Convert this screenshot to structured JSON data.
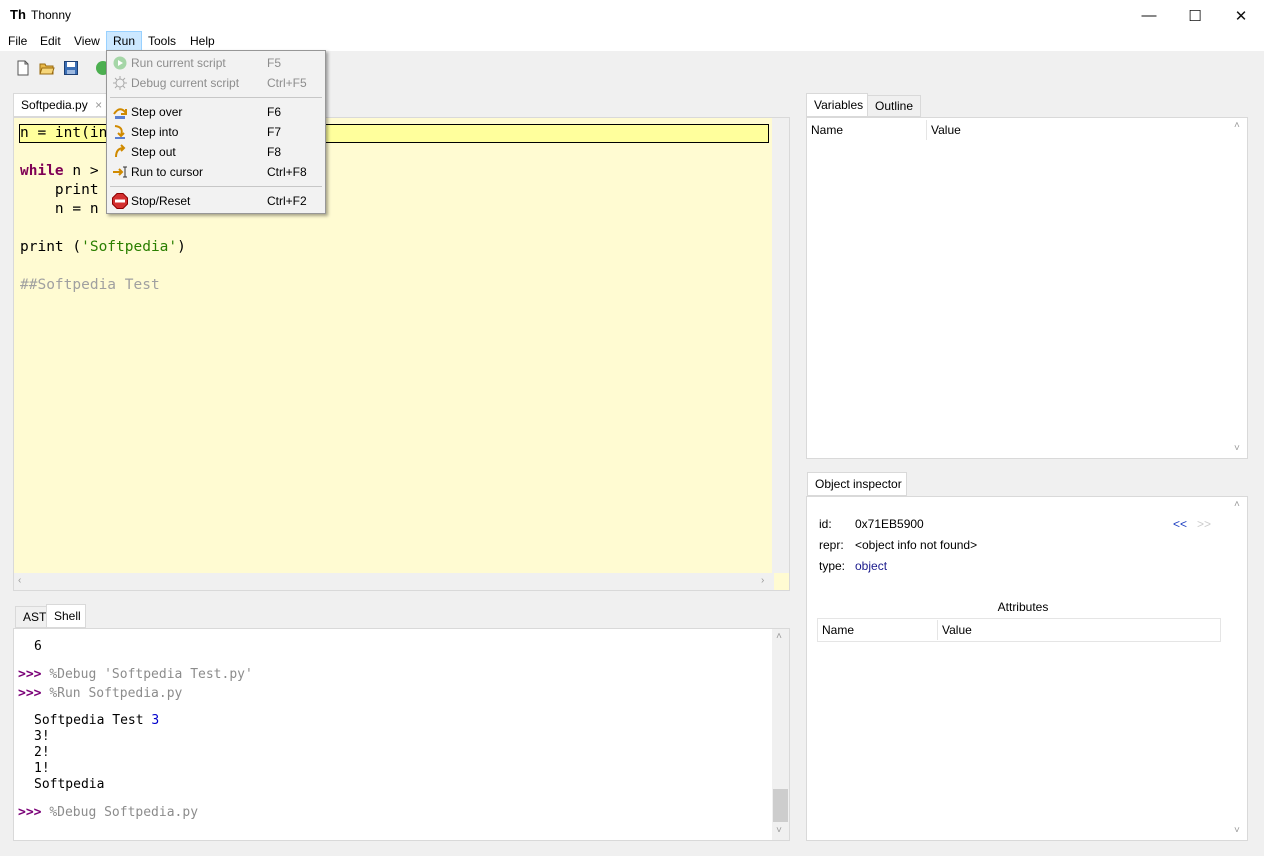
{
  "window": {
    "title": "Thonny",
    "icon": "thonny-logo-icon"
  },
  "menubar": {
    "items": [
      "File",
      "Edit",
      "View",
      "Run",
      "Tools",
      "Help"
    ],
    "active": "Run"
  },
  "run_menu": {
    "items": [
      {
        "label": "Run current script",
        "shortcut": "F5",
        "icon": "run-icon",
        "enabled": false
      },
      {
        "label": "Debug current script",
        "shortcut": "Ctrl+F5",
        "icon": "debug-icon",
        "enabled": false
      },
      {
        "label": "Step over",
        "shortcut": "F6",
        "icon": "step-over-icon",
        "enabled": true
      },
      {
        "label": "Step into",
        "shortcut": "F7",
        "icon": "step-into-icon",
        "enabled": true
      },
      {
        "label": "Step out",
        "shortcut": "F8",
        "icon": "step-out-icon",
        "enabled": true
      },
      {
        "label": "Run to cursor",
        "shortcut": "Ctrl+F8",
        "icon": "run-to-cursor-icon",
        "enabled": true
      },
      {
        "label": "Stop/Reset",
        "shortcut": "Ctrl+F2",
        "icon": "stop-icon",
        "enabled": true
      }
    ]
  },
  "toolbar": {
    "icons": [
      "new-file-icon",
      "open-file-icon",
      "save-file-icon",
      "run-icon"
    ]
  },
  "editor": {
    "tab_label": "Softpedia.py",
    "tab_close": "×",
    "lines": [
      {
        "segments": [
          {
            "text": "n = int(in",
            "style": "plain"
          }
        ]
      },
      {
        "segments": [
          {
            "text": "",
            "style": "plain"
          }
        ]
      },
      {
        "segments": [
          {
            "text": "while",
            "style": "kw"
          },
          {
            "text": " n >",
            "style": "plain"
          }
        ]
      },
      {
        "segments": [
          {
            "text": "    print",
            "style": "plain"
          }
        ]
      },
      {
        "segments": [
          {
            "text": "    n = n",
            "style": "plain"
          }
        ]
      },
      {
        "segments": [
          {
            "text": "",
            "style": "plain"
          }
        ]
      },
      {
        "segments": [
          {
            "text": "print (",
            "style": "plain"
          },
          {
            "text": "'Softpedia'",
            "style": "str"
          },
          {
            "text": ")",
            "style": "plain"
          }
        ]
      },
      {
        "segments": [
          {
            "text": "",
            "style": "plain"
          }
        ]
      },
      {
        "segments": [
          {
            "text": "##Softpedia Test",
            "style": "cmt"
          }
        ]
      }
    ]
  },
  "shell_panel": {
    "tabs": [
      "AST",
      "Shell"
    ],
    "active": "Shell",
    "lines": [
      {
        "kind": "out",
        "text": "6"
      },
      {
        "kind": "cmd",
        "prompt": ">>>",
        "text": "%Debug 'Softpedia Test.py'"
      },
      {
        "kind": "cmd",
        "prompt": ">>>",
        "text": "%Run Softpedia.py"
      },
      {
        "kind": "out",
        "text": "Softpedia Test ",
        "num": "3"
      },
      {
        "kind": "out",
        "text": "3!"
      },
      {
        "kind": "out",
        "text": "2!"
      },
      {
        "kind": "out",
        "text": "1!"
      },
      {
        "kind": "out",
        "text": "Softpedia"
      },
      {
        "kind": "cmd",
        "prompt": ">>>",
        "text": "%Debug Softpedia.py"
      }
    ]
  },
  "variables_panel": {
    "tabs": [
      "Variables",
      "Outline"
    ],
    "active": "Variables",
    "columns": [
      "Name",
      "Value"
    ]
  },
  "inspector": {
    "tab": "Object inspector",
    "id_label": "id:",
    "id_value": "0x71EB5900",
    "repr_label": "repr:",
    "repr_value": "<object info not found>",
    "type_label": "type:",
    "type_value": "object",
    "nav_back": "<<",
    "nav_forward": ">>",
    "attributes_title": "Attributes",
    "columns": [
      "Name",
      "Value"
    ]
  },
  "colors": {
    "editor_bg": "#fffbd2",
    "current_line": "#ffff9c",
    "keyword": "#7f0055",
    "string": "#2a7f00",
    "prompt": "#7a0077",
    "menu_highlight": "#cce8ff"
  }
}
